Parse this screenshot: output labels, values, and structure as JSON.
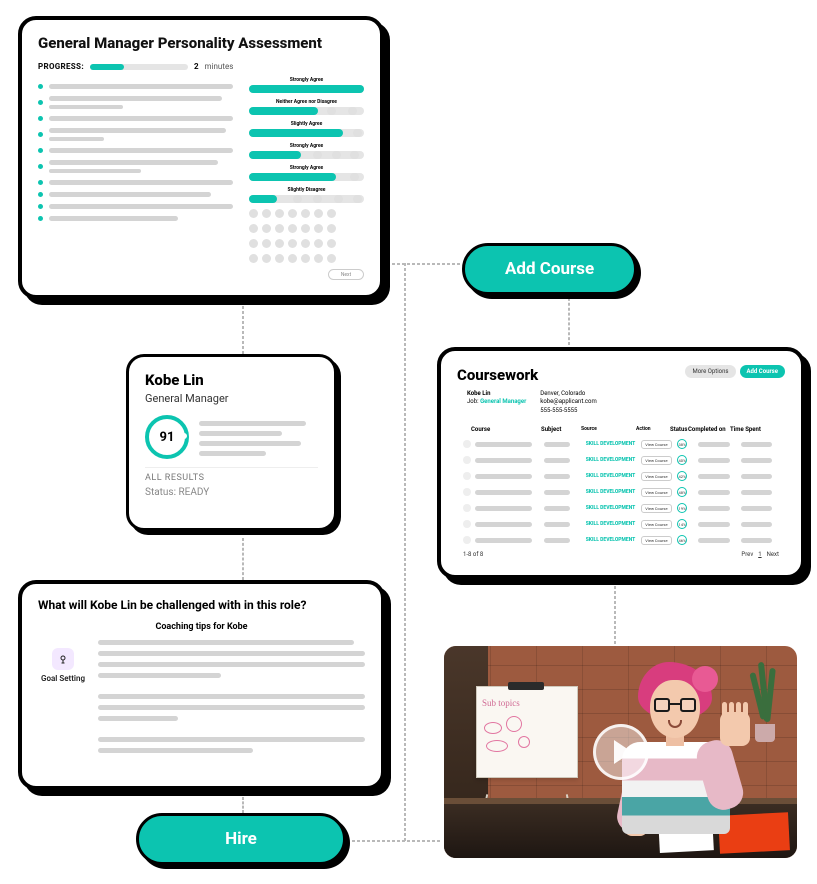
{
  "assessment": {
    "title": "General Manager Personality Assessment",
    "progress_label": "PROGRESS:",
    "progress_pct": 35,
    "progress_num": "2",
    "progress_unit": "minutes",
    "scale_labels": [
      "Strongly Agree",
      "Neither Agree nor Disagree",
      "Slightly Agree",
      "Strongly Agree",
      "Strongly Agree",
      "Slightly Disagree"
    ],
    "scale_fills": [
      100,
      60,
      82,
      45,
      76,
      24
    ],
    "next": "Next"
  },
  "profile": {
    "name": "Kobe Lin",
    "role": "General Manager",
    "score": "91",
    "all_results": "ALL RESULTS",
    "status_label": "Status:",
    "status_value": "READY"
  },
  "challenges": {
    "title": "What will Kobe Lin be challenged with in this role?",
    "coaching_title": "Coaching tips for Kobe",
    "topic": "Goal Setting"
  },
  "hire_pill": "Hire",
  "addcourse_pill": "Add Course",
  "coursework": {
    "title": "Coursework",
    "more_options": "More Options",
    "add_course": "Add Course",
    "person": {
      "name": "Kobe Lin",
      "job_label": "Job:",
      "job_value": "General Manager",
      "location": "Denver, Colorado",
      "email": "kobe@applicant.com",
      "phone": "555-555-5555"
    },
    "columns": [
      "Course",
      "Subject",
      "Source",
      "Action",
      "Status",
      "Completed on",
      "Time Spent"
    ],
    "rows": [
      {
        "source": "SKILL DEVELOPMENT",
        "action": "View Course",
        "pct": "38%"
      },
      {
        "source": "SKILL DEVELOPMENT",
        "action": "View Course",
        "pct": "40%"
      },
      {
        "source": "SKILL DEVELOPMENT",
        "action": "View Course",
        "pct": "42%"
      },
      {
        "source": "SKILL DEVELOPMENT",
        "action": "View Course",
        "pct": "48%"
      },
      {
        "source": "SKILL DEVELOPMENT",
        "action": "View Course",
        "pct": "19%"
      },
      {
        "source": "SKILL DEVELOPMENT",
        "action": "View Course",
        "pct": "14%"
      },
      {
        "source": "SKILL DEVELOPMENT",
        "action": "View Course",
        "pct": "46%"
      }
    ],
    "range": "1-8 of 8",
    "prev": "Prev",
    "page": "1",
    "next": "Next"
  },
  "video": {
    "board_title": "Sub topics"
  }
}
